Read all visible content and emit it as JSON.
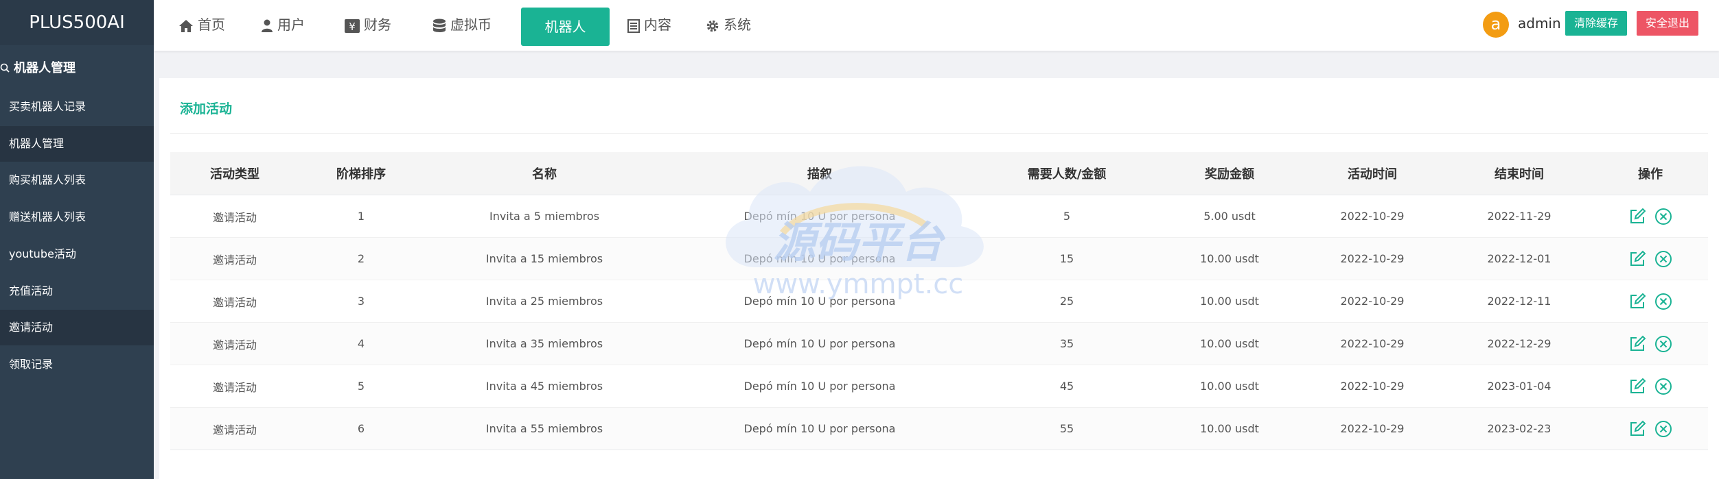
{
  "app": {
    "title": "PLUS500AI"
  },
  "sidebar": {
    "header": "机器人管理",
    "items": [
      {
        "label": "买卖机器人记录",
        "active": false
      },
      {
        "label": "机器人管理",
        "active": true
      },
      {
        "label": "购买机器人列表",
        "active": false
      },
      {
        "label": "赠送机器人列表",
        "active": false
      },
      {
        "label": "youtube活动",
        "active": false
      },
      {
        "label": "充值活动",
        "active": false
      },
      {
        "label": "邀请活动",
        "active": true
      },
      {
        "label": "领取记录",
        "active": false
      }
    ]
  },
  "topnav": {
    "items": [
      {
        "label": "首页",
        "icon": "home-icon"
      },
      {
        "label": "用户",
        "icon": "user-icon"
      },
      {
        "label": "财务",
        "icon": "yen-icon"
      },
      {
        "label": "虚拟币",
        "icon": "database-icon"
      },
      {
        "label": "机器人",
        "icon": "",
        "active": true
      },
      {
        "label": "内容",
        "icon": "list-icon"
      },
      {
        "label": "系统",
        "icon": "gear-icon"
      }
    ],
    "user": {
      "avatar_letter": "a",
      "name": "admin"
    },
    "clear_cache": "清除缓存",
    "logout": "安全退出"
  },
  "main": {
    "add_label": "添加活动",
    "table": {
      "columns": [
        "活动类型",
        "阶梯排序",
        "名称",
        "描叙",
        "需要人数/金额",
        "奖励金额",
        "活动时间",
        "结束时间",
        "操作"
      ],
      "rows": [
        [
          "邀请活动",
          "1",
          "Invita a 5 miembros",
          "Depó mín 10 U por persona",
          "5",
          "5.00 usdt",
          "2022-10-29",
          "2022-11-29"
        ],
        [
          "邀请活动",
          "2",
          "Invita a 15 miembros",
          "Depó mín 10 U por persona",
          "15",
          "10.00 usdt",
          "2022-10-29",
          "2022-12-01"
        ],
        [
          "邀请活动",
          "3",
          "Invita a 25 miembros",
          "Depó mín 10 U por persona",
          "25",
          "10.00 usdt",
          "2022-10-29",
          "2022-12-11"
        ],
        [
          "邀请活动",
          "4",
          "Invita a 35 miembros",
          "Depó mín 10 U por persona",
          "35",
          "10.00 usdt",
          "2022-10-29",
          "2022-12-29"
        ],
        [
          "邀请活动",
          "5",
          "Invita a 45 miembros",
          "Depó mín 10 U por persona",
          "45",
          "10.00 usdt",
          "2022-10-29",
          "2023-01-04"
        ],
        [
          "邀请活动",
          "6",
          "Invita a 55 miembros",
          "Depó mín 10 U por persona",
          "55",
          "10.00 usdt",
          "2022-10-29",
          "2023-02-23"
        ]
      ]
    }
  },
  "watermark": {
    "title": "源码平台",
    "url": "www.ymmpt.cc"
  },
  "colors": {
    "accent": "#1ab394",
    "danger": "#ed5565",
    "sidebar": "#2f4050",
    "avatar": "#f39c12"
  }
}
